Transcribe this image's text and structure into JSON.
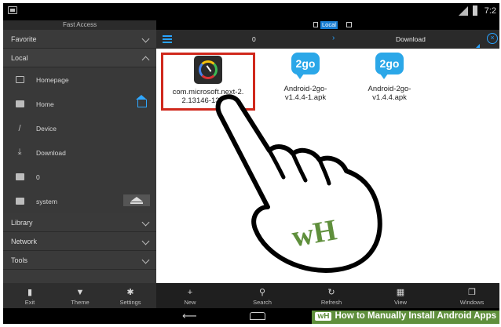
{
  "status": {
    "time": "7:2"
  },
  "drawer": {
    "title": "Fast Access",
    "sections": {
      "favorite": "Favorite",
      "local": "Local",
      "library": "Library",
      "network": "Network",
      "tools": "Tools"
    },
    "items": [
      {
        "label": "Homepage"
      },
      {
        "label": "Home"
      },
      {
        "label": "Device"
      },
      {
        "label": "Download"
      },
      {
        "label": "0"
      },
      {
        "label": "system"
      }
    ]
  },
  "location": {
    "badge": "Local"
  },
  "path": {
    "segment0": "0",
    "separator": "›",
    "segment1": "Download"
  },
  "files": [
    {
      "name": "com.microsoft.next-2.\n2.13146-13146-",
      "icon": "microsoft-next-icon",
      "selected": true
    },
    {
      "name": "Android-2go-\nv1.4.4-1.apk",
      "icon": "2go-icon",
      "icon_text": "2go"
    },
    {
      "name": "Android-2go-\nv1.4.4.apk",
      "icon": "2go-icon",
      "icon_text": "2go"
    }
  ],
  "drawer_toolbar": {
    "exit": "Exit",
    "theme": "Theme",
    "settings": "Settings"
  },
  "toolbar": {
    "new": "New",
    "search": "Search",
    "refresh": "Refresh",
    "view": "View",
    "windows": "Windows"
  },
  "watermark": {
    "logo": "wH",
    "text": "How to Manually Install Android Apps",
    "hand_logo": "wH"
  },
  "colors": {
    "accent": "#29a3ff",
    "selection": "#d0281c",
    "wikihow_green": "#5f8f3c"
  }
}
